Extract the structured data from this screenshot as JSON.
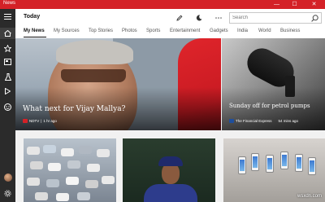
{
  "window": {
    "title": "News",
    "minimize": "—",
    "maximize": "☐",
    "close": "✕"
  },
  "header": {
    "title": "Today",
    "search_placeholder": "Search"
  },
  "tabs": [
    "My News",
    "My Sources",
    "Top Stories",
    "Photos",
    "Sports",
    "Entertainment",
    "Gadgets",
    "India",
    "World",
    "Business"
  ],
  "hero": {
    "title": "What next for Vijay Mallya?",
    "source": "NDTV",
    "time": "1 hr ago",
    "source_logo_color": "#d42127"
  },
  "side_article": {
    "title": "Sunday off for petrol pumps",
    "source": "The Financial Express",
    "time": "54 mins ago",
    "source_logo_color": "#1f4f9c"
  },
  "watermark": "wsxdn.com",
  "colors": {
    "accent": "#d42127",
    "rail": "#2b2b2b"
  },
  "icons": [
    "hamburger-icon",
    "home-icon",
    "star-icon",
    "newspaper-icon",
    "flask-icon",
    "play-icon",
    "smiley-icon",
    "avatar",
    "settings-icon",
    "pencil-icon",
    "moon-icon",
    "more-icon",
    "search-icon"
  ]
}
